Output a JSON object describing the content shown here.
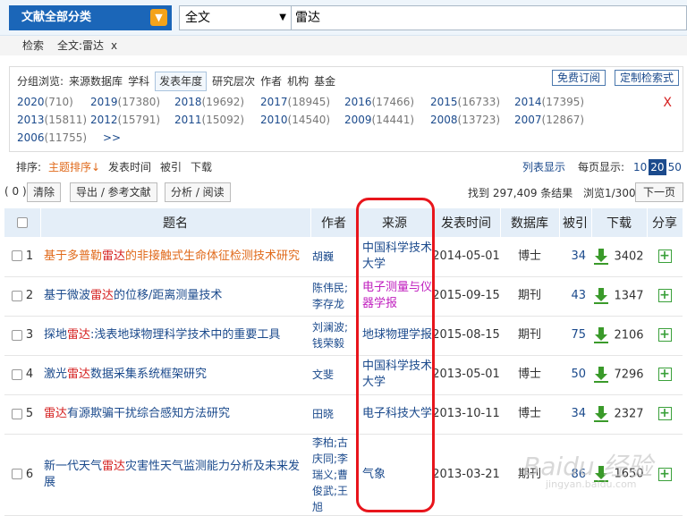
{
  "search": {
    "category": "文献全部分类",
    "field": "全文",
    "query": "雷达"
  },
  "crumb": {
    "label": "检索",
    "filter": "全文:雷达",
    "remove": "x"
  },
  "group": {
    "label": "分组浏览:",
    "items": [
      "来源数据库",
      "学科",
      "发表年度",
      "研究层次",
      "作者",
      "机构",
      "基金"
    ],
    "active": "发表年度",
    "subscribe": "免费订阅",
    "custom": "定制检索式"
  },
  "years": [
    {
      "year": "2020",
      "count": "(710)"
    },
    {
      "year": "2019",
      "count": "(17380)"
    },
    {
      "year": "2018",
      "count": "(19692)"
    },
    {
      "year": "2017",
      "count": "(18945)"
    },
    {
      "year": "2016",
      "count": "(17466)"
    },
    {
      "year": "2015",
      "count": "(16733)"
    },
    {
      "year": "2014",
      "count": "(17395)"
    },
    {
      "year": "2013",
      "count": "(15811)"
    },
    {
      "year": "2012",
      "count": "(15791)"
    },
    {
      "year": "2011",
      "count": "(15092)"
    },
    {
      "year": "2010",
      "count": "(14540)"
    },
    {
      "year": "2009",
      "count": "(14441)"
    },
    {
      "year": "2008",
      "count": "(13723)"
    },
    {
      "year": "2007",
      "count": "(12867)"
    },
    {
      "year": "2006",
      "count": "(11755)"
    }
  ],
  "years_more": ">>",
  "years_close": "X",
  "sort": {
    "label": "排序:",
    "topic": "主题排序",
    "arrow": "↓",
    "date": "发表时间",
    "cited": "被引",
    "download": "下载",
    "list": "列表显示",
    "per_page_label": "每页显示:",
    "pages": [
      "10",
      "20",
      "50"
    ],
    "active_page": "20"
  },
  "actions": {
    "selected": "( 0 )",
    "clear": "清除",
    "export": "导出 / 参考文献",
    "analyze": "分析 / 阅读",
    "result_prefix": "找到",
    "result_count": "297,409",
    "result_suffix": "条结果",
    "browse": "浏览1/300",
    "next": "下一页"
  },
  "columns": [
    "题名",
    "作者",
    "来源",
    "发表时间",
    "数据库",
    "被引",
    "下载",
    "分享"
  ],
  "rows": [
    {
      "no": "1",
      "title_pre": "基于多普勒",
      "title_hl": "雷达",
      "title_post": "的非接触式生命体征检测技术研究",
      "author": "胡巍",
      "source": "中国科学技术大学",
      "date": "2014-05-01",
      "db": "博士",
      "cited": "34",
      "downloads": "3402"
    },
    {
      "no": "2",
      "title_pre": "基于微波",
      "title_hl": "雷达",
      "title_post": "的位移/距离测量技术",
      "author": "陈伟民;李存龙",
      "source": "电子测量与仪器学报",
      "date": "2015-09-15",
      "db": "期刊",
      "cited": "43",
      "downloads": "1347"
    },
    {
      "no": "3",
      "title_pre": "探地",
      "title_hl": "雷达",
      "title_post": ":浅表地球物理科学技术中的重要工具",
      "author": "刘澜波;钱荣毅",
      "source": "地球物理学报",
      "date": "2015-08-15",
      "db": "期刊",
      "cited": "75",
      "downloads": "2106"
    },
    {
      "no": "4",
      "title_pre": "激光",
      "title_hl": "雷达",
      "title_post": "数据采集系统框架研究",
      "author": "文斐",
      "source": "中国科学技术大学",
      "date": "2013-05-01",
      "db": "博士",
      "cited": "50",
      "downloads": "7296"
    },
    {
      "no": "5",
      "title_pre": "",
      "title_hl": "雷达",
      "title_post": "有源欺骗干扰综合感知方法研究",
      "author": "田晓",
      "source": "电子科技大学",
      "date": "2013-10-11",
      "db": "博士",
      "cited": "34",
      "downloads": "2327"
    },
    {
      "no": "6",
      "title_pre": "新一代天气",
      "title_hl": "雷达",
      "title_post": "灾害性天气监测能力分析及未来发展",
      "author": "李柏;古庆同;李瑞义;曹俊武;王旭",
      "source": "气象",
      "date": "2013-03-21",
      "db": "期刊",
      "cited": "86",
      "downloads": "1650"
    }
  ],
  "colors": {
    "brand": "#1b66b8",
    "highlight": "#d52020",
    "orange": "#e06a1b",
    "magenta": "#c01fbf",
    "annotation": "#e8151c"
  },
  "watermark": {
    "text": "Baidu 经验",
    "sub": "jingyan.baidu.com"
  }
}
